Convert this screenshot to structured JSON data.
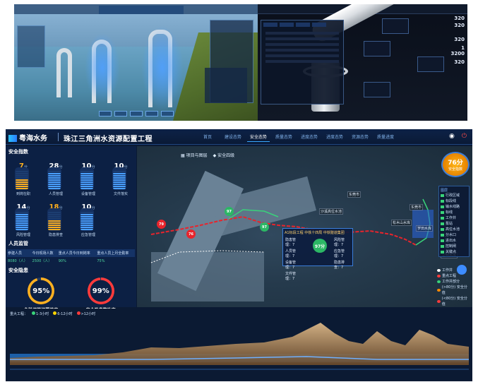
{
  "top_right": {
    "numbers": [
      "320",
      "320",
      "320",
      "1",
      "3200",
      "320"
    ]
  },
  "header": {
    "logo_text": "粤海水务",
    "title": "珠江三角洲水资源配置工程",
    "nav": [
      "首页",
      "建设态势",
      "安全态势",
      "质量态势",
      "进度态势",
      "进度态势",
      "资源态势",
      "质量进度"
    ],
    "active_nav_index": 2
  },
  "safety": {
    "title": "安全指数",
    "unit": "分",
    "gauges": [
      {
        "value": "7",
        "label": "到岗在职",
        "color": "#ffb020",
        "level": 0.5
      },
      {
        "value": "28",
        "label": "人员管理",
        "color": "#4aa0ff",
        "level": 0.9
      },
      {
        "value": "10",
        "label": "设备管理",
        "color": "#4aa0ff",
        "level": 0.9
      },
      {
        "value": "10",
        "label": "文件落实",
        "color": "#4aa0ff",
        "level": 0.9
      },
      {
        "value": "14",
        "label": "风险管理",
        "color": "#4aa0ff",
        "level": 0.9
      },
      {
        "value": "18",
        "label": "隐患排查",
        "color": "#ffb020",
        "level": 0.6
      },
      {
        "value": "10",
        "label": "应急管理",
        "color": "#4aa0ff",
        "level": 0.9
      }
    ]
  },
  "personnel": {
    "title": "人员监管",
    "headers": [
      "参建人员",
      "今日现场人数",
      "重点人员今日到岗率",
      "重点人员上月全勤率"
    ],
    "values": [
      "8080（人）",
      "2500（人）",
      "90%",
      "75%"
    ]
  },
  "hazards": {
    "title": "安全隐患",
    "rings": [
      {
        "value": "95%",
        "label": "危险源管控覆盖率",
        "color": "#ffb020",
        "ratio": 0.95
      },
      {
        "value": "99%",
        "label": "安全隐患整改率",
        "color": "#ff3b3b",
        "ratio": 0.99
      }
    ]
  },
  "map": {
    "toolbar": [
      "项目与图层",
      "安全四级"
    ],
    "score": {
      "value": "76分",
      "label": "安全指数"
    },
    "legend_title": "图层",
    "legend": [
      "行政区域",
      "标段线",
      "输水线路",
      "标线",
      "工作井",
      "泵站",
      "高位水池",
      "分水口",
      "进出水",
      "控制闸",
      "关键点"
    ],
    "legend2": [
      {
        "label": "工作井",
        "color": "#ffffff"
      },
      {
        "label": "重点工程",
        "color": "#ff3b3b"
      },
      {
        "label": "工作井部分",
        "color": "#39d37a"
      },
      {
        "label": "(>80分) 安全分值",
        "color": "#ff8a00"
      },
      {
        "label": "(<80分) 安全分值",
        "color": "#ff3b3b"
      }
    ],
    "pins": [
      {
        "value": "79",
        "color": "#e8242c"
      },
      {
        "value": "76",
        "color": "#e8242c"
      },
      {
        "value": "97",
        "color": "#2cb765"
      },
      {
        "value": "97",
        "color": "#2cb765"
      }
    ],
    "popup": {
      "title": "A1标段工程  中铁十四局  中铁隧道集团",
      "score": "97分",
      "rows": [
        "隐患管理：7",
        "人员管理：7",
        "设备管理：7",
        "文件管理：7",
        "风险管理：7",
        "应急管理：7",
        "隐患排查：7"
      ]
    },
    "labels": [
      "东莞市",
      "东莞市",
      "沙溪高位水池",
      "罗田水库",
      "松木山水库",
      "公明水库"
    ]
  },
  "profile": {
    "legend_prefix": "重大工程：",
    "legend": [
      {
        "label": "1-3小时",
        "color": "#39d37a"
      },
      {
        "label": "6-12小时",
        "color": "#ffd400"
      },
      {
        "label": ">12小时",
        "color": "#ff3b3b"
      }
    ]
  }
}
